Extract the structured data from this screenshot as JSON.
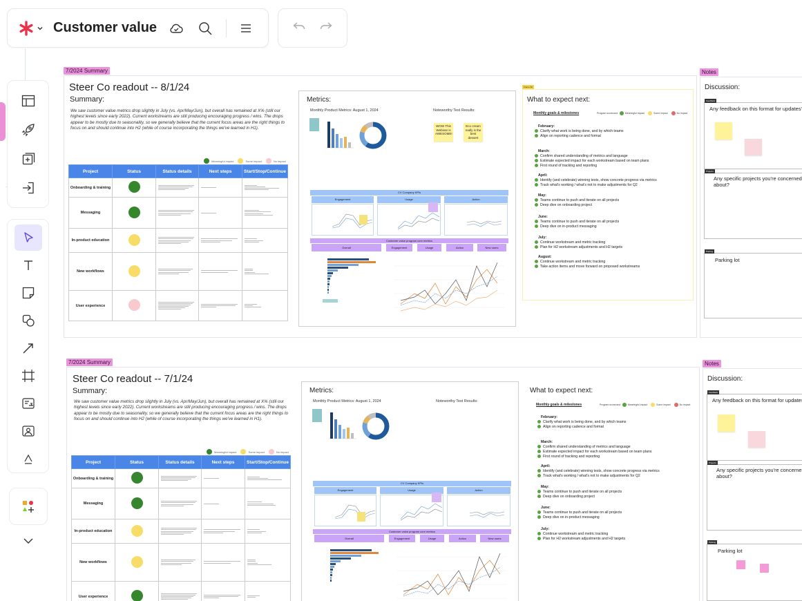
{
  "app": {
    "board_title": "Customer value",
    "colors": {
      "accent": "#e8334a",
      "tool_active": "#e8e6ff",
      "frame_tag": "#e995dd",
      "table_header": "#4a86e8"
    }
  },
  "toolbar": {
    "icons": [
      "asterisk-logo-icon",
      "chevron-down-icon",
      "cloud-check-icon",
      "search-icon",
      "menu-icon"
    ],
    "undo_icons": [
      "undo-icon",
      "redo-icon"
    ]
  },
  "left_tools": {
    "panel_a": [
      "table-icon",
      "rocket-icon",
      "add-frame-icon",
      "import-icon"
    ],
    "panel_b": [
      "pointer-icon",
      "text-icon",
      "sticky-note-icon",
      "shapes-icon",
      "line-icon",
      "frame-icon",
      "convert-icon",
      "image-icon",
      "more-tools-icon"
    ],
    "panel_c": [
      "apps-icon",
      "chevron-down-icon"
    ]
  },
  "frames": [
    {
      "tag": "7/2024 Summary",
      "title": "Steer Co readout -- 8/1/24",
      "summary_label": "Summary:",
      "summary_text": "We saw customer value metrics drop slightly in July (vs. Apr/May/Jun), but overall has remained at X% (still our highest levels since early 2022). Current workstreams are still producing encouraging progress / wins. The drops appear to be mostly due to seasonality, so we generally believe that the current focus areas are the right things to focus on and should continue into H2 (while of course incorporating the things we've learned in H1).",
      "legend": [
        "Meaningful impact",
        "Some impact",
        "No impact"
      ],
      "table_headers": [
        "Project",
        "Status",
        "Status details",
        "Next steps",
        "Start/Stop/Continue"
      ],
      "rows": [
        {
          "project": "Onboarding & training",
          "status": "green"
        },
        {
          "project": "Messaging",
          "status": "green"
        },
        {
          "project": "In-product education",
          "status": "yellow"
        },
        {
          "project": "New workflows",
          "status": "yellow"
        },
        {
          "project": "User experience",
          "status": "pink"
        }
      ],
      "metrics_heading": "Metrics:",
      "monthly_caption": "Monthly Product Metrics: August 1, 2024",
      "test_caption": "Noteworthy Test Results:",
      "stickies": [
        "WOW This Webinar is AWESOME!",
        "Eco cream really is the best dessert"
      ],
      "kpi_title": "CV Company KPIs",
      "kpi_heads": [
        "Engagement",
        "Usage",
        "Action"
      ],
      "cv_title": "Customer value program core metrics",
      "cv_heads": [
        "Overall",
        "Engagement",
        "Usage",
        "Action",
        "New users"
      ],
      "expect_tag": "Frame 39",
      "expect_heading": "What to expect next:",
      "goals_label": "Monthly goals & milestones",
      "goals_legend": "Program scorecard:",
      "months": [
        {
          "name": "February:",
          "items": [
            "Clarify what work is being done, and by which teams",
            "Align on reporting cadence and format"
          ]
        },
        {
          "name": "March:",
          "items": [
            "Confirm shared understanding of metrics and language",
            "Estimate expected impact for each workstream based on team plans",
            "First round of tracking and reporting"
          ]
        },
        {
          "name": "April:",
          "items": [
            "Identify (and celebrate) winning tests, show concrete progress via metrics",
            "Track what's working / what's not to make adjustments for Q2"
          ]
        },
        {
          "name": "May:",
          "items": [
            "Teams continue to push and iterate on all projects",
            "Deep dive on onboarding project"
          ]
        },
        {
          "name": "June:",
          "items": [
            "Teams continue to push and iterate on all  projects",
            "Deep dive on in-product messaging"
          ]
        },
        {
          "name": "July:",
          "items": [
            "Continue workstream and metric tracking",
            "Plan for H2 workstream adjustments and H2 targets"
          ]
        },
        {
          "name": "August:",
          "items": [
            "Continue workstream and metric tracking",
            "Take action items and move forward on proposed workstreams"
          ]
        }
      ],
      "notes_tag": "Notes",
      "discussion": "Discussion:",
      "note_cards": [
        "Any feedback on this format for updates?",
        "Any specific projects you're concerned about?",
        "Parking lot"
      ]
    },
    {
      "tag": "7/2024 Summary",
      "title": "Steer Co readout -- 7/1/24",
      "summary_label": "Summary:",
      "summary_text": "We saw customer value metrics drop slightly in July (vs. Apr/May/Jun), but overall has remained at X% (still our highest levels since early 2022). Current workstreams are still producing encouraging progress / wins. The drops appear to be mostly due to seasonality, so we generally believe that the current focus areas are the right things to focus on and should continue into H2 (while of course incorporating the things we've learned in H1).",
      "legend": [
        "Meaningful impact",
        "Some impact",
        "No impact"
      ],
      "table_headers": [
        "Project",
        "Status",
        "Status details",
        "Next steps",
        "Start/Stop/Continue"
      ],
      "rows": [
        {
          "project": "Onboarding & training",
          "status": "green"
        },
        {
          "project": "Messaging",
          "status": "green"
        },
        {
          "project": "In-product education",
          "status": "yellow"
        },
        {
          "project": "New workflows",
          "status": "yellow"
        },
        {
          "project": "User experience",
          "status": "green"
        }
      ],
      "metrics_heading": "Metrics:",
      "monthly_caption": "Monthly Product Metrics: August 1, 2024",
      "test_caption": "Noteworthy Test Results:",
      "kpi_title": "CV Company KPIs",
      "kpi_heads": [
        "Engagement",
        "Usage",
        "Action"
      ],
      "cv_title": "Customer value program core metrics",
      "cv_heads": [
        "Overall",
        "Engagement",
        "Usage",
        "Action",
        "New users"
      ],
      "expect_heading": "What to expect next:",
      "goals_label": "Monthly goals & milestones",
      "goals_legend": "Program scorecard:",
      "months": [
        {
          "name": "February:",
          "items": [
            "Clarify what work is being done, and by which teams",
            "Align on reporting cadence and format"
          ]
        },
        {
          "name": "March:",
          "items": [
            "Confirm shared understanding of metrics and language",
            "Estimate expected impact for each workstream based on team plans",
            "First round of tracking and reporting"
          ]
        },
        {
          "name": "April:",
          "items": [
            "Identify (and celebrate) winning tests, show concrete progress via metrics",
            "Track what's working / what's not to make adjustments for Q2"
          ]
        },
        {
          "name": "May:",
          "items": [
            "Teams continue to push and iterate on all projects",
            "Deep dive on onboarding project"
          ]
        },
        {
          "name": "June:",
          "items": [
            "Teams continue to push and iterate on all  projects",
            "Deep dive on in-product messaging"
          ]
        },
        {
          "name": "July:",
          "items": [
            "Continue workstream and metric tracking",
            "Plan for H2 workstream adjustments and H2 targets"
          ]
        }
      ],
      "notes_tag": "Notes",
      "discussion": "Discussion:",
      "note_cards": [
        "Any feedback on this format for updates?",
        "Any specific projects you're concerned about?",
        "Parking lot"
      ]
    }
  ]
}
